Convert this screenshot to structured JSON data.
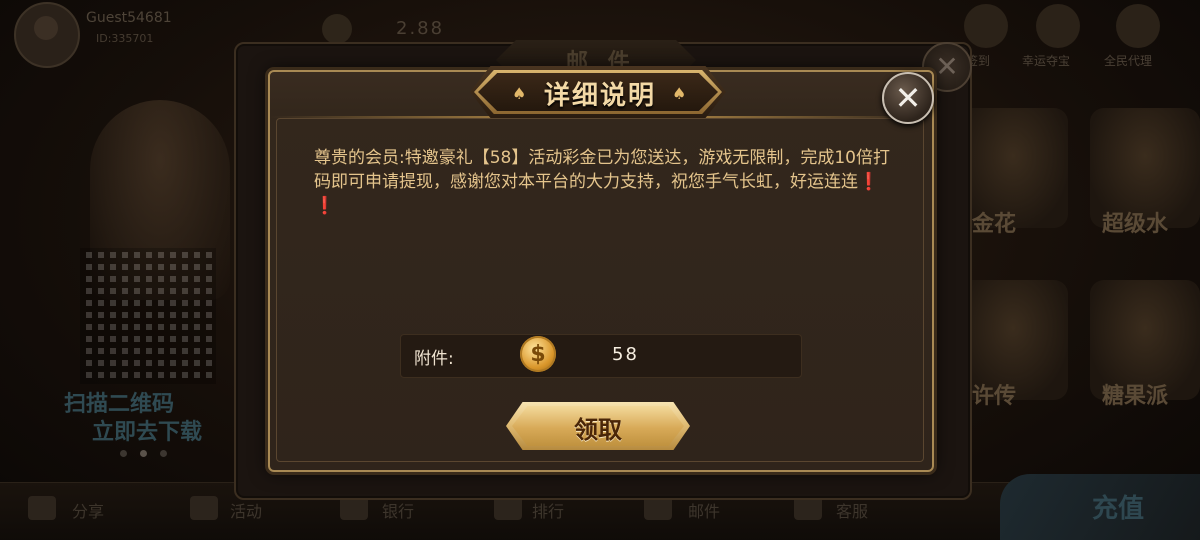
{
  "lobby": {
    "guest_name": "Guest54681",
    "guest_id": "ID:335701",
    "balance": "2.88",
    "top_icons": [
      {
        "label": "签到",
        "icon": "calendar-icon"
      },
      {
        "label": "幸运夺宝",
        "icon": "treasure-icon"
      },
      {
        "label": "全民代理",
        "icon": "agent-crown-icon"
      }
    ],
    "scan_text": "扫描二维码",
    "download_text": "立即去下载",
    "games": [
      "金花",
      "超级水",
      "许传",
      "糖果派"
    ],
    "bottom_nav": [
      "分享",
      "活动",
      "银行",
      "排行",
      "邮件",
      "客服"
    ],
    "recharge": "充值"
  },
  "mail_panel": {
    "title": "邮 件",
    "close_symbol": "✕"
  },
  "dialog": {
    "title": "详细说明",
    "close_symbol": "✕",
    "message": "尊贵的会员:特邀豪礼【58】活动彩金已为您送达，游戏无限制，完成10倍打码即可申请提现，感谢您对本平台的大力支持，祝您手气长虹，好运连连",
    "message_suffix": "❗❗",
    "attachment_label": "附件:",
    "attachment_icon": "gold-coin-icon",
    "coin_symbol": "$",
    "attachment_amount": "58",
    "claim_button": "领取"
  },
  "colors": {
    "message_text": "#e4c48c",
    "title_text": "#f3d9a6",
    "dialog_border": "#a98a54",
    "claim_button_gold": "#e2be76"
  }
}
